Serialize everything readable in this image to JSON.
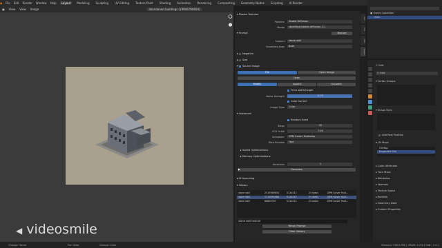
{
  "menu": {
    "items": [
      "File",
      "Edit",
      "Render",
      "Window",
      "Help"
    ],
    "workspaces": [
      "Layout",
      "Modeling",
      "Sculpting",
      "UV Editing",
      "Texture Paint",
      "Shading",
      "Animation",
      "Rendering",
      "Compositing",
      "Geometry Nodes",
      "Scripting",
      "AI Render"
    ],
    "active_workspace": "Layout",
    "scene": "Scene",
    "view_layer": "ViewLayer"
  },
  "viewport_header": {
    "view": "View",
    "view2": "View",
    "image": "Image",
    "image_name": "abandoned buildings (19906790604)"
  },
  "props": {
    "panel_title": "Dream Textures",
    "pipeline_label": "Pipeline",
    "pipeline_value": "Stable Diffusion",
    "model_label": "Model",
    "model_value": "stabilityai/stable-diffusion-2-1",
    "prompt_header": "Prompt",
    "prompt_mode": "Texture",
    "subject_label": "Subject",
    "subject_value": "stone wall",
    "seamless_label": "Seamless Axes",
    "seamless_value": "Both",
    "negative": "Negative",
    "size": "Size",
    "source_image": "Source Image",
    "file_btn": "File",
    "open_image_btn": "Open Image",
    "open_btn": "Open",
    "mode_modify": "Modify",
    "mode_inpaint": "Inpaint",
    "mode_outpaint": "Outpaint",
    "fit_label": "Fit to width/height",
    "noise_label": "Noise Strength",
    "noise_value": "0.75",
    "color_correct": "Color Correct",
    "image_type_label": "Image Type",
    "image_type_value": "Color",
    "advanced": "Advanced",
    "random_seed": "Random Seed",
    "steps_label": "Steps",
    "steps_value": "25",
    "cfg_label": "CFG Scale",
    "cfg_value": "7.50",
    "scheduler_label": "Scheduler",
    "scheduler_value": "DPM Solver Multistep",
    "step_preview_label": "Step Preview",
    "step_preview_value": "Fast",
    "speed_opt": "Speed Optimizations",
    "memory_opt": "Memory Optimizations",
    "iterations_label": "Iterations",
    "iterations_value": "1",
    "generate": "Generate",
    "upscaling": "AI Upscaling",
    "history": "History",
    "history_rows": [
      {
        "prompt": "stone wall",
        "seed": "2315969830",
        "size": "512x512",
        "steps": "25 steps",
        "sched": "DPM Solver Mult..."
      },
      {
        "prompt": "stone wall",
        "seed": "1714959486",
        "size": "512x512",
        "steps": "25 steps",
        "sched": "DPM Solver Mult..."
      },
      {
        "prompt": "stone wall",
        "seed": "80605787",
        "size": "512x512",
        "steps": "25 steps",
        "sched": "DPM Solver Mult..."
      }
    ],
    "history_filter": "stone wall texture",
    "recall_prompt": "Recall Prompt",
    "clear_history": "Clear History"
  },
  "side_tabs": [
    "Item",
    "Tool",
    "View",
    "Dream"
  ],
  "outliner": {
    "title": "Scene Collection",
    "item": "Grid"
  },
  "right_props": {
    "object_name": "Grid",
    "data_name": "Grid",
    "vertex_groups": "Vertex Groups",
    "shape_keys": "Shape Keys",
    "add_rest": "Add Rest Position",
    "uv_maps": "UV Maps",
    "uvmap": "UVMap",
    "projected": "Projected UVs",
    "sections": [
      "Color Attributes",
      "Face Maps",
      "Attributes",
      "Normals",
      "Texture Space",
      "Remesh",
      "Geometry Data",
      "Custom Properties"
    ]
  },
  "statusbar": {
    "left": "Change Frame",
    "mid": "Pan View",
    "mid2": "Sample Color",
    "right": "Memory: 556.8 MiB | VRAM: 3.7/4.0 GiB | 3.4.1"
  },
  "watermark": "videosmile"
}
